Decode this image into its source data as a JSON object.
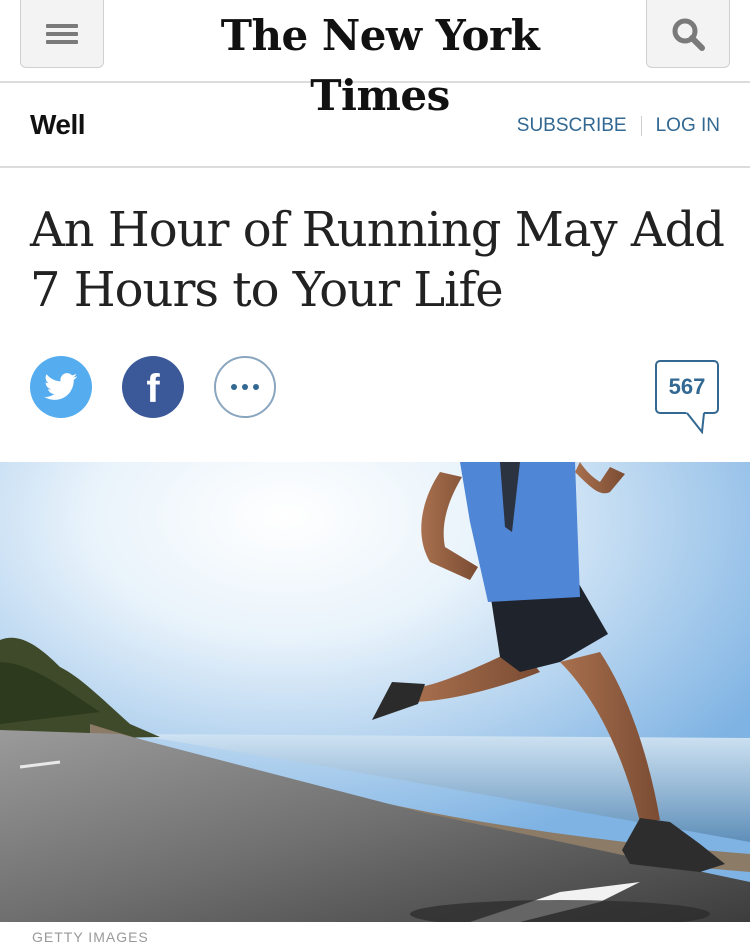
{
  "header": {
    "logo_text": "The New York Times",
    "menu_icon": "hamburger-menu-icon",
    "search_icon": "search-icon"
  },
  "section": {
    "name": "Well",
    "subscribe_label": "SUBSCRIBE",
    "login_label": "LOG IN"
  },
  "article": {
    "headline_line1": "An Hour of Running May Add",
    "headline_line2": "7 Hours to Your Life",
    "comment_count": "567",
    "image_credit": "GETTY IMAGES"
  },
  "share": {
    "twitter_icon": "twitter-icon",
    "facebook_icon": "facebook-icon",
    "facebook_glyph": "f",
    "more_icon": "more-options-icon"
  },
  "colors": {
    "link_blue": "#326891",
    "twitter_blue": "#55acee",
    "facebook_blue": "#3b5998",
    "headline_text": "#222222"
  }
}
